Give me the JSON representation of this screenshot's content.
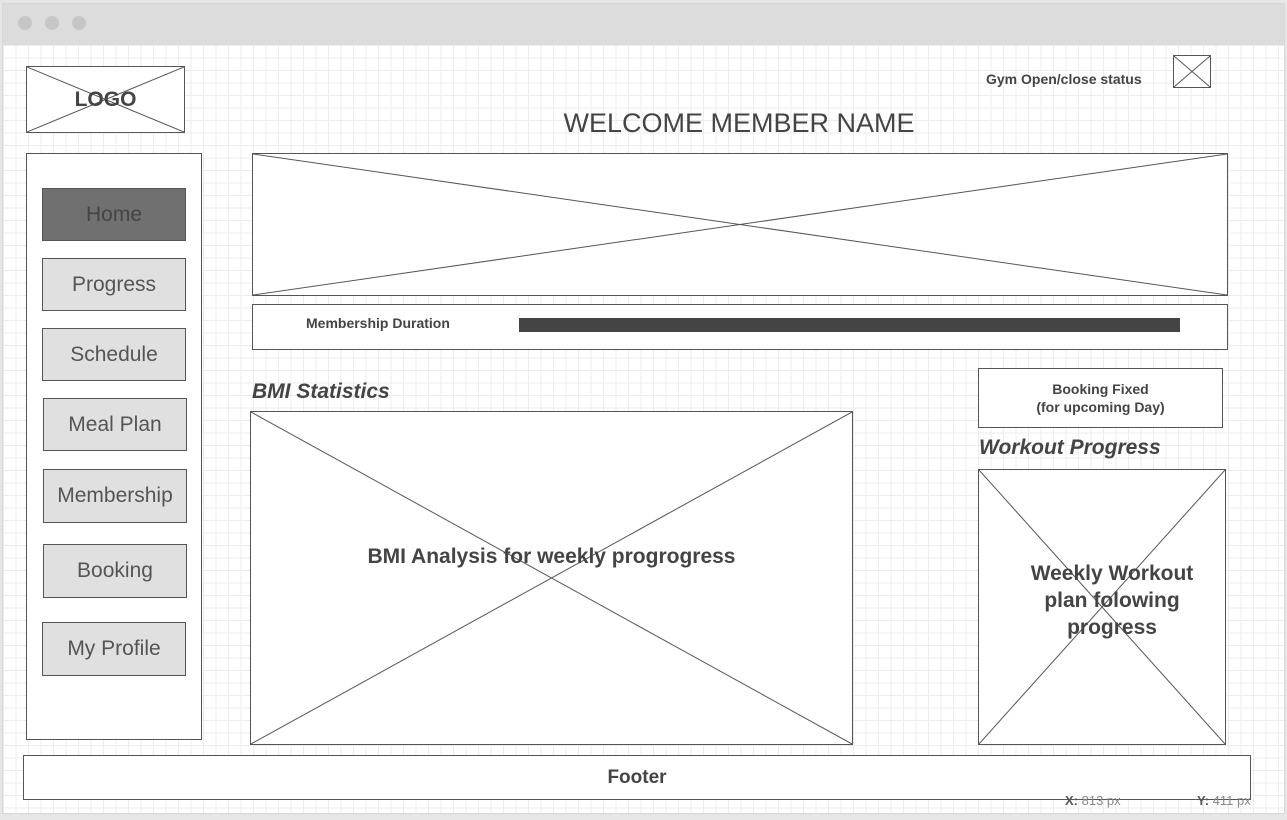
{
  "header": {
    "logo_label": "LOGO",
    "gym_status_label": "Gym Open/close status",
    "welcome_title": "WELCOME MEMBER NAME"
  },
  "sidebar": {
    "items": [
      {
        "label": "Home",
        "active": true
      },
      {
        "label": "Progress",
        "active": false
      },
      {
        "label": "Schedule",
        "active": false
      },
      {
        "label": "Meal Plan",
        "active": false
      },
      {
        "label": "Membership",
        "active": false
      },
      {
        "label": "Booking",
        "active": false
      },
      {
        "label": "My Profile",
        "active": false
      }
    ]
  },
  "membership": {
    "label": "Membership Duration",
    "progress": 1.0,
    "bar_color": "#444444"
  },
  "bmi": {
    "heading": "BMI Statistics",
    "placeholder_text": "BMI Analysis for weekly progrogress"
  },
  "booking": {
    "line1": "Booking Fixed",
    "line2": "(for upcoming Day)"
  },
  "workout": {
    "heading": "Workout  Progress",
    "placeholder_text": "Weekly Workout plan folowing progress"
  },
  "footer": {
    "label": "Footer"
  },
  "status_bar": {
    "x_label": "X:",
    "x_value": "813 px",
    "y_label": "Y:",
    "y_value": "411 px"
  },
  "colors": {
    "active_nav": "#707070",
    "nav_button": "#e0e0e0",
    "border": "#555555"
  }
}
